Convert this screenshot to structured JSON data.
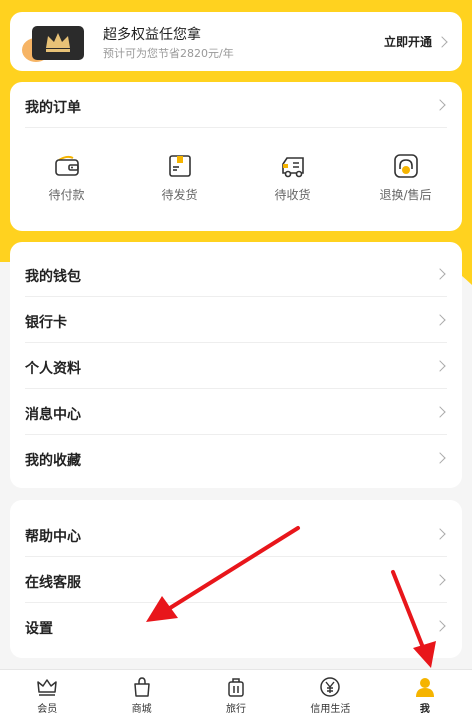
{
  "membership": {
    "title": "超多权益任您拿",
    "subtitle": "预计可为您节省2820元/年",
    "action": "立即开通"
  },
  "orders": {
    "title": "我的订单",
    "items": [
      {
        "label": "待付款",
        "icon": "wallet-icon"
      },
      {
        "label": "待发货",
        "icon": "package-icon"
      },
      {
        "label": "待收货",
        "icon": "delivery-truck-icon"
      },
      {
        "label": "退换/售后",
        "icon": "headset-icon"
      }
    ]
  },
  "menu_group_1": [
    {
      "label": "我的钱包"
    },
    {
      "label": "银行卡"
    },
    {
      "label": "个人资料"
    },
    {
      "label": "消息中心"
    },
    {
      "label": "我的收藏"
    }
  ],
  "menu_group_2": [
    {
      "label": "帮助中心"
    },
    {
      "label": "在线客服"
    },
    {
      "label": "设置"
    }
  ],
  "tabbar": [
    {
      "label": "会员",
      "icon": "crown-icon",
      "active": false
    },
    {
      "label": "商城",
      "icon": "shopping-bag-icon",
      "active": false
    },
    {
      "label": "旅行",
      "icon": "luggage-icon",
      "active": false
    },
    {
      "label": "信用生活",
      "icon": "yen-coin-icon",
      "active": false
    },
    {
      "label": "我",
      "icon": "user-icon",
      "active": true
    }
  ],
  "colors": {
    "accent": "#ffd21f",
    "annotation": "#e8161b"
  }
}
